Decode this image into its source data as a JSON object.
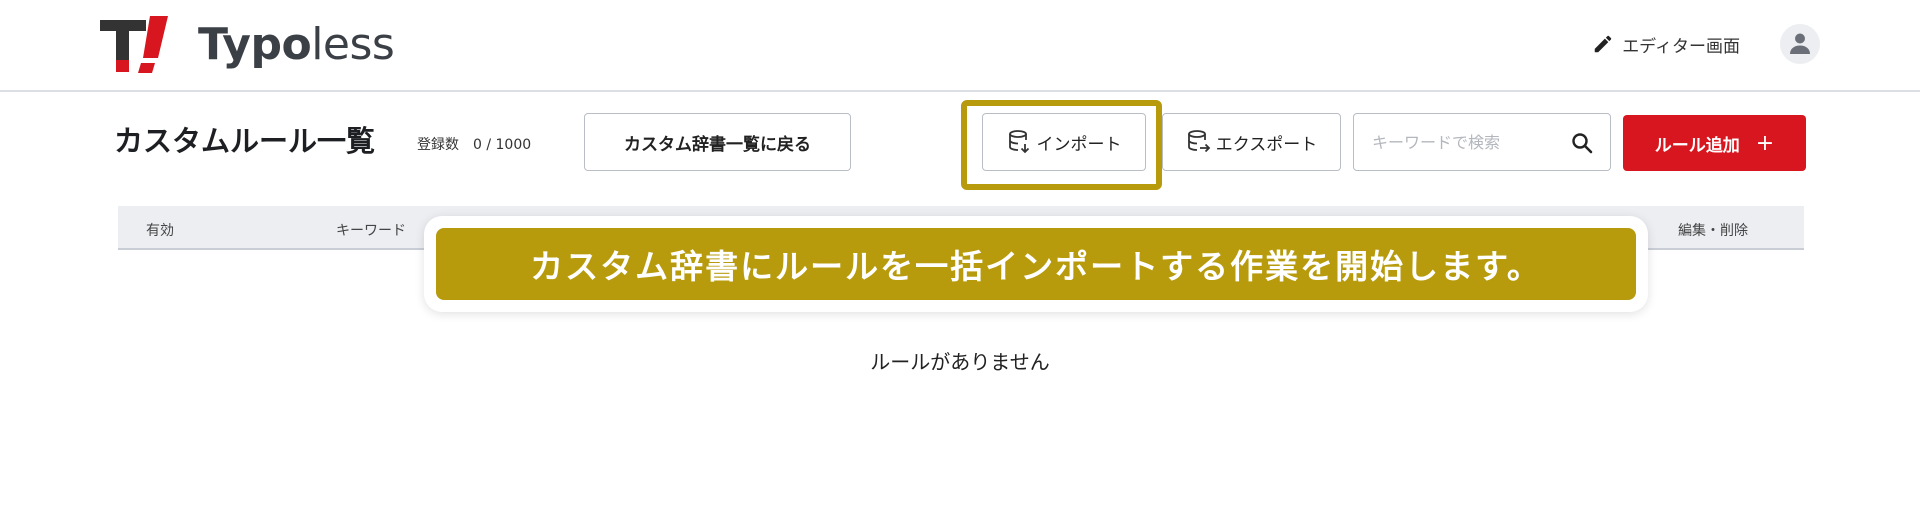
{
  "header": {
    "logo": {
      "mark": "T!",
      "text_bold": "Typo",
      "text_light": "less"
    },
    "editor_link": {
      "icon": "pencil-icon",
      "label": "エディター画面"
    },
    "avatar": {
      "icon": "user-icon"
    }
  },
  "toolbar": {
    "title": "カスタムルール一覧",
    "count_label": "登録数",
    "count_value": "0 / 1000",
    "back_button": "カスタム辞書一覧に戻る",
    "import_button": "インポート",
    "export_button": "エクスポート",
    "search_placeholder": "キーワードで検索",
    "add_button": "ルール追加",
    "add_icon": "+"
  },
  "table": {
    "columns": [
      "有効",
      "キーワード",
      "編集・削除"
    ],
    "empty_message": "ルールがありません"
  },
  "tooltip": {
    "message": "カスタム辞書にルールを一括インポートする作業を開始します。"
  },
  "colors": {
    "accent": "#d7161f",
    "highlight": "#b79b0d",
    "header_bg": "#eceef2"
  }
}
